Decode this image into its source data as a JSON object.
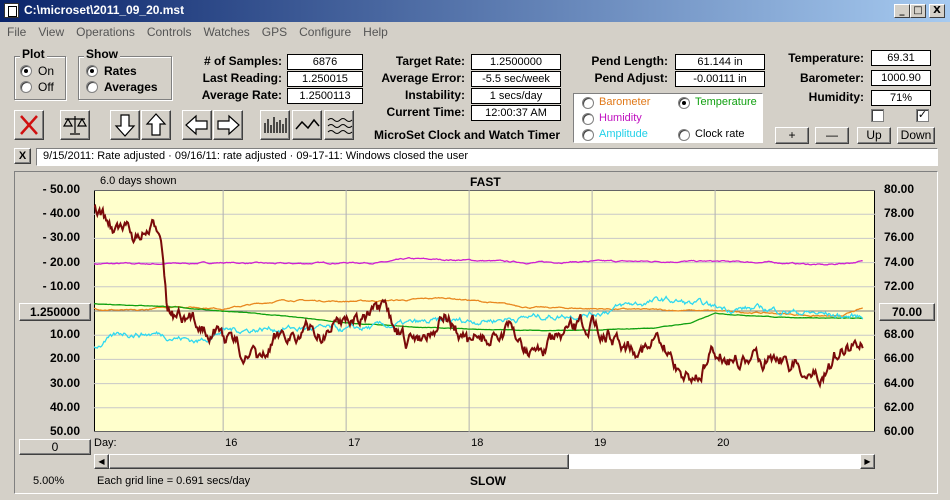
{
  "window": {
    "title": "C:\\microset\\2011_09_20.mst"
  },
  "window_controls": {
    "minimize": "_",
    "maximize": "□",
    "close": "X"
  },
  "menu": [
    "File",
    "View",
    "Operations",
    "Controls",
    "Watches",
    "GPS",
    "Configure",
    "Help"
  ],
  "plot_group": {
    "title": "Plot",
    "options": [
      "On",
      "Off"
    ],
    "selected": "On"
  },
  "show_group": {
    "title": "Show",
    "options": [
      "Rates",
      "Averages"
    ],
    "selected": "Rates"
  },
  "stats": {
    "samples_label": "# of Samples:",
    "samples": "6876",
    "last_reading_label": "Last Reading:",
    "last_reading": "1.250015",
    "average_rate_label": "Average Rate:",
    "average_rate": "1.2500113",
    "target_rate_label": "Target Rate:",
    "target_rate": "1.2500000",
    "average_error_label": "Average Error:",
    "average_error": "-5.5 sec/week",
    "instability_label": "Instability:",
    "instability": "1 secs/day",
    "current_time_label": "Current Time:",
    "current_time": "12:00:37 AM",
    "pend_length_label": "Pend Length:",
    "pend_length": "61.144 in",
    "pend_adjust_label": "Pend Adjust:",
    "pend_adjust": "-0.00111 in",
    "temperature_label": "Temperature:",
    "temperature": "69.31",
    "barometer_label": "Barometer:",
    "barometer": "1000.90",
    "humidity_label": "Humidity:",
    "humidity": "71%"
  },
  "app_caption": "MicroSet Clock and Watch Timer",
  "series_selector": {
    "options": [
      {
        "label": "Barometer",
        "color": "#e07818",
        "selected": false
      },
      {
        "label": "Temperature",
        "color": "#10a010",
        "selected": true
      },
      {
        "label": "Humidity",
        "color": "#c010c0",
        "selected": false
      },
      {
        "label": "Amplitude",
        "color": "#20d0e8",
        "selected": false
      },
      {
        "label": "Clock rate",
        "color": "#000000",
        "selected": false
      }
    ]
  },
  "scale_buttons": {
    "plus": "+",
    "minus": "—",
    "up": "Up",
    "down": "Down"
  },
  "checkboxes": [
    false,
    true
  ],
  "notes_close": "X",
  "notes_text": "9/15/2011: Rate adjusted  · 09/16/11: rate adjusted  · 09-17-11: Windows closed the user",
  "graph": {
    "days_shown": "6.0 days shown",
    "top_label": "FAST",
    "bottom_label": "SLOW",
    "day_label": "Day:",
    "day_ticks": [
      "16",
      "17",
      "18",
      "19",
      "20"
    ],
    "left_axis": [
      "- 50.00",
      "- 40.00",
      "- 30.00",
      "- 20.00",
      "- 10.00",
      "",
      "10.00",
      "20.00",
      "30.00",
      "40.00",
      "50.00"
    ],
    "right_axis": [
      "80.00",
      "78.00",
      "76.00",
      "74.00",
      "72.00",
      "70.00",
      "68.00",
      "66.00",
      "64.00",
      "62.00",
      "60.00"
    ],
    "center_left_button": "1.250000",
    "center_right_button": "70.00",
    "bottom_left_button": "0",
    "scale_percent": "5.00%",
    "grid_note": "Each grid line = 0.691 secs/day",
    "background": "#ffffcc"
  },
  "chart_data": {
    "type": "line",
    "x_unit": "day",
    "xlim": [
      14.95,
      21.3
    ],
    "left_ylim": [
      -50,
      50
    ],
    "right_ylim": [
      60,
      80
    ],
    "series": [
      {
        "name": "Humidity",
        "color": "#d020d0",
        "axis": "right",
        "x": [
          14.95,
          15.5,
          16.0,
          16.5,
          17.0,
          17.3,
          17.5,
          18.0,
          18.5,
          19.0,
          19.5,
          20.0,
          20.5,
          20.9,
          21.2
        ],
        "y": [
          73.9,
          73.9,
          74.0,
          73.9,
          74.0,
          74.0,
          74.3,
          74.2,
          74.0,
          74.1,
          74.1,
          74.1,
          74.0,
          73.8,
          74.1
        ]
      },
      {
        "name": "Barometer",
        "color": "#e88820",
        "axis": "right",
        "x": [
          14.95,
          15.3,
          15.6,
          16.0,
          16.5,
          17.0,
          17.5,
          17.8,
          18.0,
          18.5,
          19.0,
          19.5,
          20.0,
          20.5,
          21.0,
          21.2
        ],
        "y": [
          70.2,
          70.0,
          70.4,
          70.2,
          70.9,
          70.8,
          70.9,
          71.1,
          70.9,
          70.3,
          70.2,
          70.1,
          70.0,
          69.8,
          69.5,
          70.2
        ]
      },
      {
        "name": "Temperature",
        "color": "#10a010",
        "axis": "right",
        "x": [
          14.95,
          15.5,
          16.0,
          16.5,
          17.0,
          17.5,
          18.0,
          18.5,
          19.0,
          19.5,
          19.8,
          20.0,
          20.5,
          21.0,
          21.2
        ],
        "y": [
          70.6,
          70.4,
          70.0,
          69.6,
          69.0,
          68.7,
          68.5,
          68.4,
          68.4,
          68.6,
          69.0,
          69.8,
          69.5,
          69.4,
          69.4
        ]
      },
      {
        "name": "Amplitude",
        "color": "#30d8f0",
        "axis": "right",
        "x": [
          14.95,
          15.2,
          15.5,
          15.8,
          16.0,
          16.5,
          17.0,
          17.5,
          18.0,
          18.5,
          19.0,
          19.3,
          19.6,
          20.0,
          20.5,
          21.0,
          21.2
        ],
        "y": [
          67.0,
          68.2,
          68.1,
          67.5,
          68.4,
          68.6,
          68.4,
          68.9,
          69.2,
          69.5,
          69.8,
          70.5,
          70.9,
          70.3,
          70.1,
          69.6,
          69.5
        ]
      },
      {
        "name": "Clock rate",
        "color": "#7a0a0a",
        "axis": "left",
        "x": [
          14.95,
          15.1,
          15.3,
          15.5,
          15.55,
          15.7,
          15.9,
          16.1,
          16.3,
          16.5,
          16.8,
          17.0,
          17.3,
          17.5,
          17.8,
          18.0,
          18.3,
          18.5,
          18.8,
          19.0,
          19.3,
          19.5,
          19.8,
          20.0,
          20.3,
          20.5,
          20.8,
          21.0,
          21.2
        ],
        "y": [
          -41,
          -35,
          -30,
          -33,
          -2,
          7,
          5,
          14,
          23,
          8,
          10,
          2,
          3,
          15,
          1,
          15,
          8,
          17,
          12,
          5,
          13,
          14,
          28,
          17,
          22,
          16,
          27,
          18,
          12
        ]
      }
    ]
  }
}
